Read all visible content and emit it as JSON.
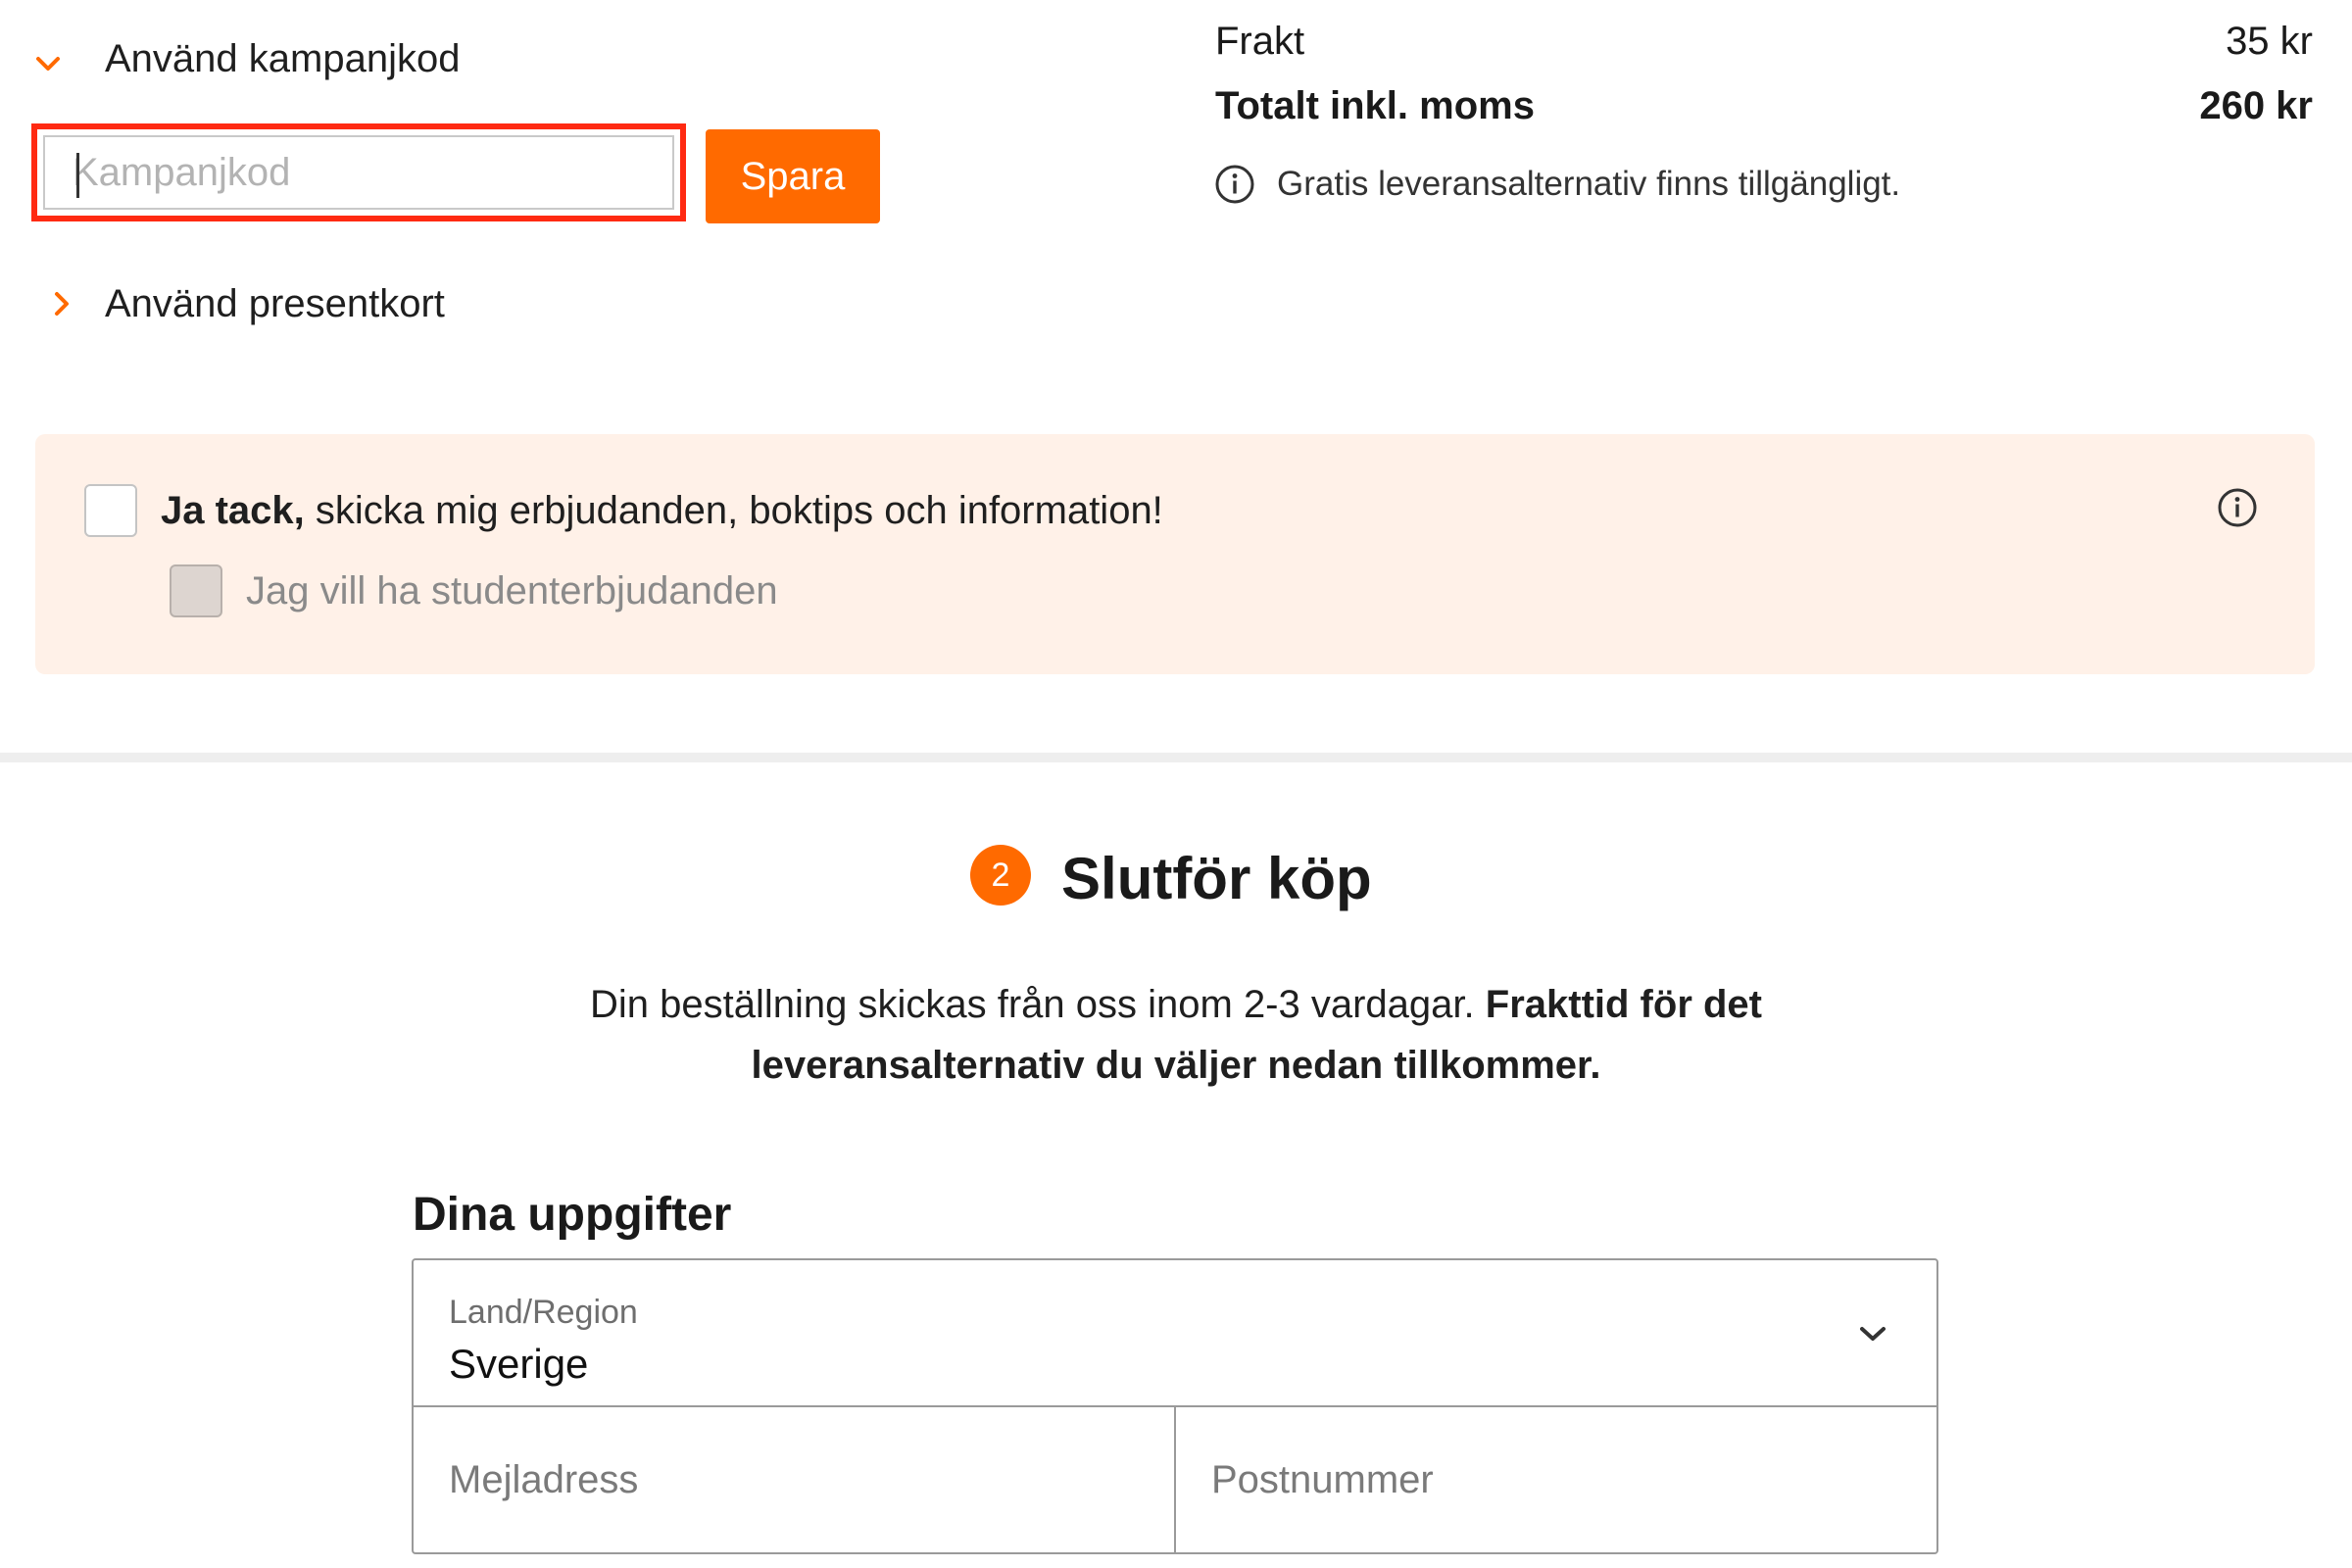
{
  "promo": {
    "campaign_toggle_label": "Använd kampanjkod",
    "campaign_placeholder": "Kampanjkod",
    "save_label": "Spara",
    "giftcard_toggle_label": "Använd presentkort"
  },
  "summary": {
    "shipping_label": "Frakt",
    "shipping_value": "35 kr",
    "total_label": "Totalt inkl. moms",
    "total_value": "260 kr",
    "free_delivery_note": "Gratis leveransalternativ finns tillgängligt."
  },
  "newsletter": {
    "optin_bold": "Ja tack,",
    "optin_text": " skicka mig erbjudanden, boktips och information!",
    "student_label": "Jag vill ha studenterbjudanden"
  },
  "checkout": {
    "step_number": "2",
    "step_title": "Slutför köp",
    "delivery_text": "Din beställning skickas från oss inom 2-3 vardagar.",
    "delivery_bold_line1": "Frakttid för det",
    "delivery_bold_line2": "leveransalternativ du väljer nedan tillkommer."
  },
  "details": {
    "title": "Dina uppgifter",
    "country_label": "Land/Region",
    "country_value": "Sverige",
    "email_placeholder": "Mejladress",
    "postal_placeholder": "Postnummer"
  },
  "colors": {
    "accent": "#ff6a00",
    "highlight": "#ff2a12",
    "panel_bg": "#fff1e8"
  }
}
